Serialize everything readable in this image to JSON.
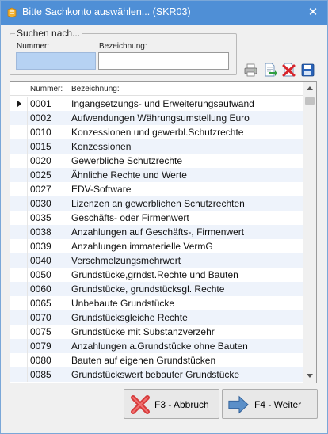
{
  "window": {
    "title": "Bitte Sachkonto auswählen...  (SKR03)",
    "close_glyph": "✕",
    "accent_color": "#4f8fd6"
  },
  "search": {
    "legend": "Suchen nach...",
    "nummer_label": "Nummer:",
    "bezeichnung_label": "Bezeichnung:",
    "nummer_value": "",
    "bezeichnung_value": ""
  },
  "toolbar": {
    "icons": [
      "print-icon",
      "export-icon",
      "delete-icon",
      "save-icon"
    ]
  },
  "grid": {
    "columns": {
      "nummer": "Nummer:",
      "bezeichnung": "Bezeichnung:"
    },
    "selected_index": 0,
    "rows": [
      {
        "nummer": "0001",
        "bezeichnung": "Ingangsetzungs- und Erweiterungsaufwand"
      },
      {
        "nummer": "0002",
        "bezeichnung": "Aufwendungen Währungsumstellung Euro"
      },
      {
        "nummer": "0010",
        "bezeichnung": "Konzessionen und gewerbl.Schutzrechte"
      },
      {
        "nummer": "0015",
        "bezeichnung": "Konzessionen"
      },
      {
        "nummer": "0020",
        "bezeichnung": "Gewerbliche Schutzrechte"
      },
      {
        "nummer": "0025",
        "bezeichnung": "Ähnliche Rechte und Werte"
      },
      {
        "nummer": "0027",
        "bezeichnung": "EDV-Software"
      },
      {
        "nummer": "0030",
        "bezeichnung": "Lizenzen an gewerblichen Schutzrechten"
      },
      {
        "nummer": "0035",
        "bezeichnung": "Geschäfts- oder Firmenwert"
      },
      {
        "nummer": "0038",
        "bezeichnung": "Anzahlungen auf Geschäfts-, Firmenwert"
      },
      {
        "nummer": "0039",
        "bezeichnung": "Anzahlungen immaterielle VermG"
      },
      {
        "nummer": "0040",
        "bezeichnung": "Verschmelzungsmehrwert"
      },
      {
        "nummer": "0050",
        "bezeichnung": "Grundstücke,grndst.Rechte und Bauten"
      },
      {
        "nummer": "0060",
        "bezeichnung": "Grundstücke, grundstücksgl. Rechte"
      },
      {
        "nummer": "0065",
        "bezeichnung": "Unbebaute Grundstücke"
      },
      {
        "nummer": "0070",
        "bezeichnung": "Grundstücksgleiche Rechte"
      },
      {
        "nummer": "0075",
        "bezeichnung": "Grundstücke mit Substanzverzehr"
      },
      {
        "nummer": "0079",
        "bezeichnung": "Anzahlungen a.Grundstücke ohne Bauten"
      },
      {
        "nummer": "0080",
        "bezeichnung": "Bauten auf eigenen Grundstücken"
      },
      {
        "nummer": "0085",
        "bezeichnung": "Grundstückswert bebauter Grundstücke"
      }
    ]
  },
  "buttons": {
    "abbruch": "F3 - Abbruch",
    "weiter": "F4 - Weiter"
  }
}
